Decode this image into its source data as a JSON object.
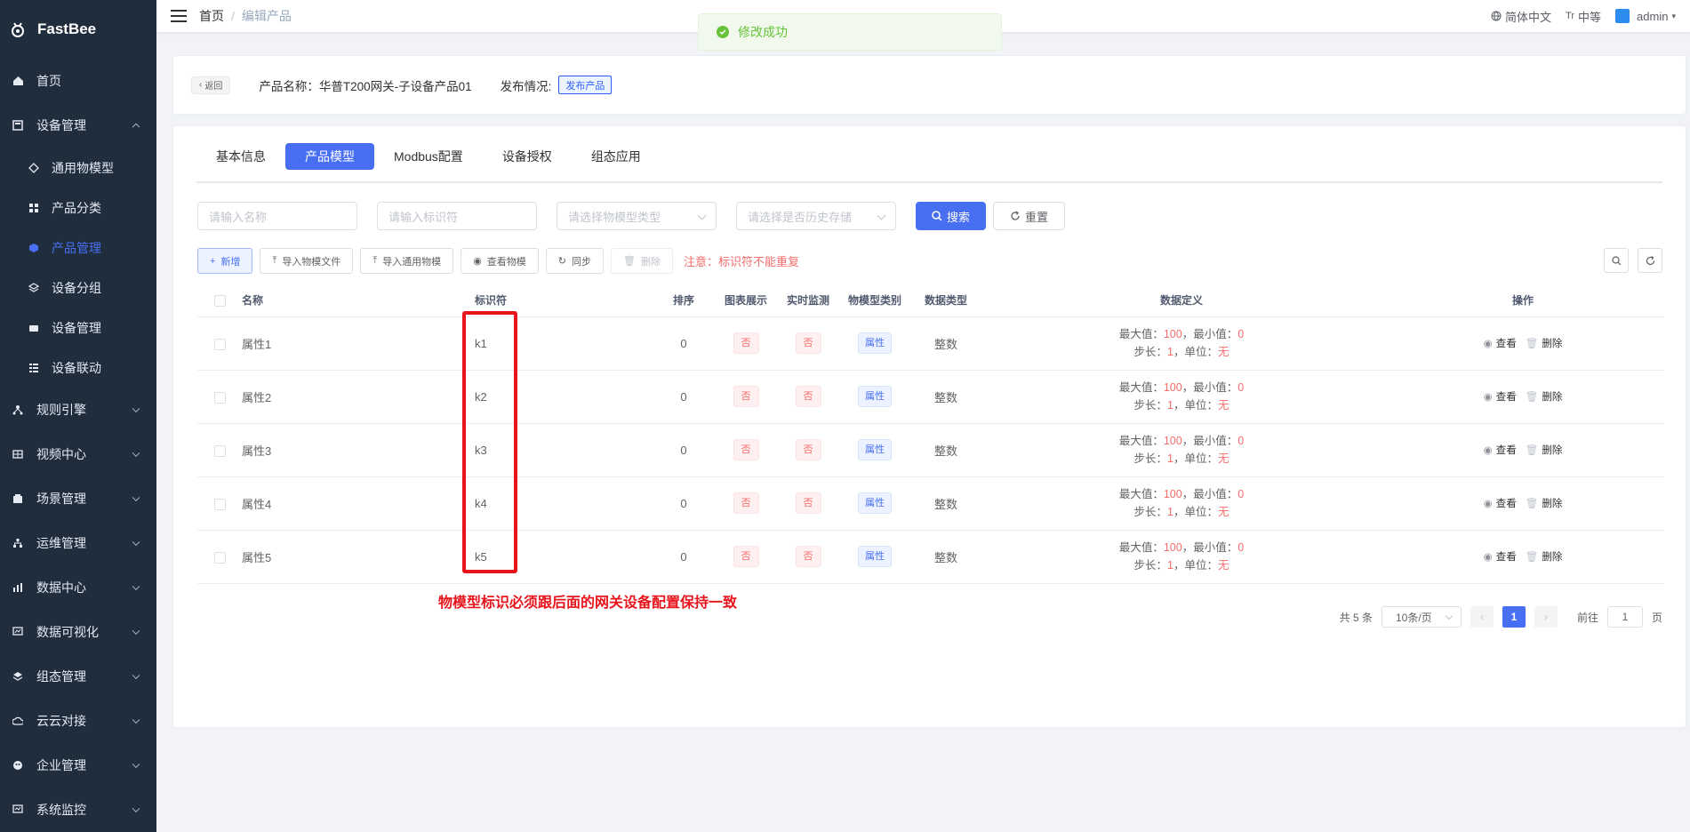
{
  "app": {
    "name": "FastBee"
  },
  "sidebar": {
    "items": [
      {
        "label": "首页"
      },
      {
        "label": "设备管理"
      },
      {
        "label": "规则引擎"
      },
      {
        "label": "视频中心"
      },
      {
        "label": "场景管理"
      },
      {
        "label": "运维管理"
      },
      {
        "label": "数据中心"
      },
      {
        "label": "数据可视化"
      },
      {
        "label": "组态管理"
      },
      {
        "label": "云云对接"
      },
      {
        "label": "企业管理"
      },
      {
        "label": "系统监控"
      }
    ],
    "sub": [
      {
        "label": "通用物模型"
      },
      {
        "label": "产品分类"
      },
      {
        "label": "产品管理"
      },
      {
        "label": "设备分组"
      },
      {
        "label": "设备管理"
      },
      {
        "label": "设备联动"
      }
    ]
  },
  "header": {
    "breadcrumb": {
      "home": "首页",
      "sep": "/",
      "current": "编辑产品"
    },
    "lang": "简体中文",
    "size": "中等",
    "user": "admin"
  },
  "toast": {
    "text": "修改成功"
  },
  "product": {
    "back": "返回",
    "name": "产品名称：华普T200网关-子设备产品01",
    "pub_label": "发布情况:",
    "pub_tag": "发布产品"
  },
  "tabs": [
    "基本信息",
    "产品模型",
    "Modbus配置",
    "设备授权",
    "组态应用"
  ],
  "filters": {
    "name_ph": "请输入名称",
    "id_ph": "请输入标识符",
    "type_ph": "请选择物模型类型",
    "hist_ph": "请选择是否历史存储",
    "search": "搜索",
    "reset": "重置"
  },
  "toolbar": {
    "add": "新增",
    "import_file": "导入物模文件",
    "import_common": "导入通用物模",
    "view": "查看物模",
    "sync": "同步",
    "delete": "删除",
    "warn": "注意：标识符不能重复"
  },
  "table": {
    "headers": [
      "名称",
      "标识符",
      "排序",
      "图表展示",
      "实时监测",
      "物模型类别",
      "数据类型",
      "数据定义",
      "操作"
    ],
    "def_labels": {
      "max": "最大值：",
      "min": "，最小值：",
      "step": "步长：",
      "unit": "，单位："
    },
    "ops": {
      "view": "查看",
      "delete": "删除"
    },
    "rows": [
      {
        "name": "属性1",
        "id": "k1",
        "order": "0",
        "chart": "否",
        "monitor": "否",
        "cat": "属性",
        "dtype": "整数",
        "max": "100",
        "min": "0",
        "step": "1",
        "unit": "无"
      },
      {
        "name": "属性2",
        "id": "k2",
        "order": "0",
        "chart": "否",
        "monitor": "否",
        "cat": "属性",
        "dtype": "整数",
        "max": "100",
        "min": "0",
        "step": "1",
        "unit": "无"
      },
      {
        "name": "属性3",
        "id": "k3",
        "order": "0",
        "chart": "否",
        "monitor": "否",
        "cat": "属性",
        "dtype": "整数",
        "max": "100",
        "min": "0",
        "step": "1",
        "unit": "无"
      },
      {
        "name": "属性4",
        "id": "k4",
        "order": "0",
        "chart": "否",
        "monitor": "否",
        "cat": "属性",
        "dtype": "整数",
        "max": "100",
        "min": "0",
        "step": "1",
        "unit": "无"
      },
      {
        "name": "属性5",
        "id": "k5",
        "order": "0",
        "chart": "否",
        "monitor": "否",
        "cat": "属性",
        "dtype": "整数",
        "max": "100",
        "min": "0",
        "step": "1",
        "unit": "无"
      }
    ]
  },
  "annotation": "物模型标识必须跟后面的网关设备配置保持一致",
  "pager": {
    "total": "共 5 条",
    "size": "10条/页",
    "current": "1",
    "goto": "前往",
    "page_input": "1",
    "page_unit": "页"
  },
  "colors": {
    "accent": "#486ff2",
    "sidebar": "#1f2d3d",
    "danger": "#f56c6c",
    "success": "#67c23a",
    "annotation": "#e8141c"
  }
}
